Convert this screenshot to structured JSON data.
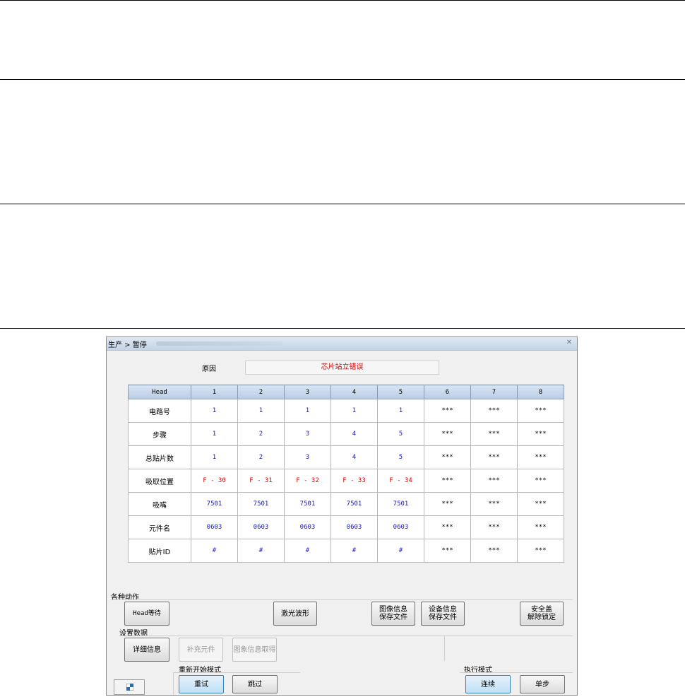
{
  "window": {
    "title": "生产 > 暂停"
  },
  "reason": {
    "label": "原因",
    "value": "芯片站立错误"
  },
  "table": {
    "columns": [
      "Head",
      "1",
      "2",
      "3",
      "4",
      "5",
      "6",
      "7",
      "8"
    ],
    "rows": [
      {
        "label": "电路号",
        "values": [
          "1",
          "1",
          "1",
          "1",
          "1",
          "***",
          "***",
          "***"
        ]
      },
      {
        "label": "步骤",
        "values": [
          "1",
          "2",
          "3",
          "4",
          "5",
          "***",
          "***",
          "***"
        ]
      },
      {
        "label": "总贴片数",
        "values": [
          "1",
          "2",
          "3",
          "4",
          "5",
          "***",
          "***",
          "***"
        ]
      },
      {
        "label": "吸取位置",
        "values": [
          "F - 30",
          "F - 31",
          "F - 32",
          "F - 33",
          "F - 34",
          "***",
          "***",
          "***"
        ]
      },
      {
        "label": "吸嘴",
        "values": [
          "7501",
          "7501",
          "7501",
          "7501",
          "7501",
          "***",
          "***",
          "***"
        ]
      },
      {
        "label": "元件名",
        "values": [
          "0603",
          "0603",
          "0603",
          "0603",
          "0603",
          "***",
          "***",
          "***"
        ]
      },
      {
        "label": "贴片ID",
        "values": [
          "#",
          "#",
          "#",
          "#",
          "#",
          "***",
          "***",
          "***"
        ]
      }
    ]
  },
  "actions": {
    "label": "各种动作",
    "head_wait": "Head等待",
    "laser_waveform": "激光波形",
    "image_save": "图像信息\n保存文件",
    "device_save": "设备信息\n保存文件",
    "safety_unlock": "安全盖\n解除锁定"
  },
  "settings": {
    "label": "设置数据",
    "detail_info": "详细信息",
    "supplement": "补充元件",
    "image_acquire": "图象信息取得"
  },
  "restart": {
    "label": "重新开始模式",
    "retry": "重试",
    "skip": "跳过"
  },
  "exec": {
    "label": "执行模式",
    "continuous": "连续",
    "step": "单步"
  },
  "colors": {
    "error_text": "#e00000",
    "value_text": "#1a1ab0",
    "header_bg": "#c8d8ec",
    "active_button": "#bfe0f6"
  }
}
